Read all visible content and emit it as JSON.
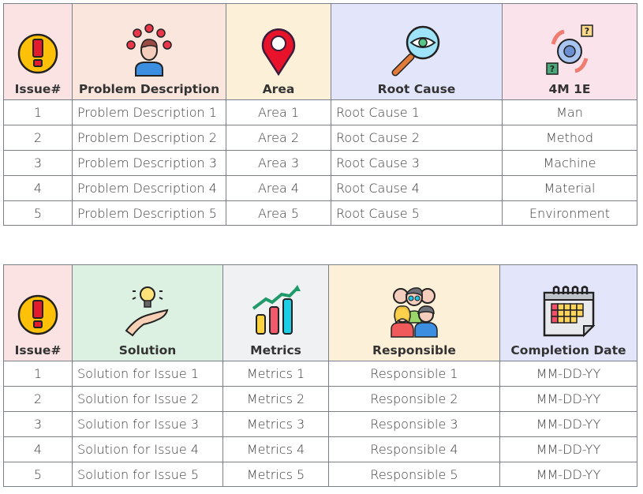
{
  "table1": {
    "headers": [
      {
        "label": "Issue#",
        "icon": "exclamation-warning-icon",
        "bg": "#fbe3e3"
      },
      {
        "label": "Problem Description",
        "icon": "person-with-problems-icon",
        "bg": "#fae6dc"
      },
      {
        "label": "Area",
        "icon": "location-pin-icon",
        "bg": "#fdf0d8"
      },
      {
        "label": "Root Cause",
        "icon": "magnifier-eye-icon",
        "bg": "#e3e5fb"
      },
      {
        "label": "4M 1E",
        "icon": "gear-cycle-question-icon",
        "bg": "#fbe3ec"
      }
    ],
    "rows": [
      [
        "1",
        "Problem Description 1",
        "Area 1",
        "Root Cause 1",
        "Man"
      ],
      [
        "2",
        "Problem Description 2",
        "Area 2",
        "Root Cause 2",
        "Method"
      ],
      [
        "3",
        "Problem Description 3",
        "Area 3",
        "Root Cause 3",
        "Machine"
      ],
      [
        "4",
        "Problem Description 4",
        "Area 4",
        "Root Cause 4",
        "Material"
      ],
      [
        "5",
        "Problem Description 5",
        "Area 5",
        "Root Cause 5",
        "Environment"
      ]
    ]
  },
  "table2": {
    "headers": [
      {
        "label": "Issue#",
        "icon": "exclamation-warning-icon",
        "bg": "#fbe3e3"
      },
      {
        "label": "Solution",
        "icon": "lightbulb-hand-icon",
        "bg": "#dcf1e1"
      },
      {
        "label": "Metrics",
        "icon": "growth-chart-icon",
        "bg": "#f0f1f3"
      },
      {
        "label": "Responsible",
        "icon": "team-people-icon",
        "bg": "#fdf0d8"
      },
      {
        "label": "Completion Date",
        "icon": "calendar-icon",
        "bg": "#e3e5fb"
      }
    ],
    "rows": [
      [
        "1",
        "Solution for Issue 1",
        "Metrics 1",
        "Responsible 1",
        "MM-DD-YY"
      ],
      [
        "2",
        "Solution for Issue 2",
        "Metrics 2",
        "Responsible 2",
        "MM-DD-YY"
      ],
      [
        "3",
        "Solution for Issue 3",
        "Metrics 3",
        "Responsible 3",
        "MM-DD-YY"
      ],
      [
        "4",
        "Solution for Issue 4",
        "Metrics 4",
        "Responsible 4",
        "MM-DD-YY"
      ],
      [
        "5",
        "Solution for Issue 5",
        "Metrics 5",
        "Responsible 5",
        "MM-DD-YY"
      ]
    ]
  }
}
